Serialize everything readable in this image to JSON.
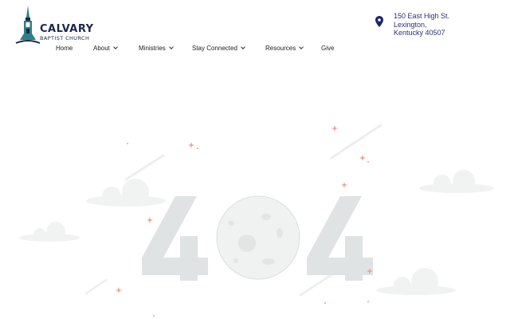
{
  "logo": {
    "name": "CALVARY",
    "subtitle": "BAPTIST CHURCH"
  },
  "address": {
    "line1": "150 East High St.",
    "line2": "Lexington,",
    "line3": "Kentucky 40507"
  },
  "nav": {
    "items": [
      {
        "label": "Home",
        "dropdown": false
      },
      {
        "label": "About",
        "dropdown": true
      },
      {
        "label": "Ministries",
        "dropdown": true
      },
      {
        "label": "Stay Connected",
        "dropdown": true
      },
      {
        "label": "Resources",
        "dropdown": true
      },
      {
        "label": "Give",
        "dropdown": false
      }
    ]
  },
  "error_illustration": {
    "digits": [
      "4",
      "0",
      "4"
    ],
    "icon": "404-moon-illustration"
  },
  "colors": {
    "brand_navy": "#1c2748",
    "address_blue": "#2a2f7a",
    "digit_gray": "#dfe3e3",
    "star_coral": "#f0a391"
  }
}
